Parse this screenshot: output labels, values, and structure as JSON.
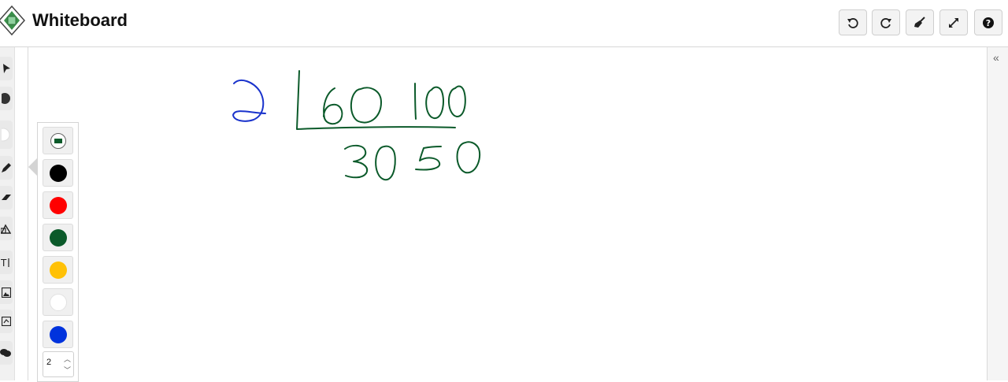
{
  "header": {
    "title": "Whiteboard",
    "buttons": [
      {
        "name": "undo-button",
        "icon": "undo-icon"
      },
      {
        "name": "redo-button",
        "icon": "redo-icon"
      },
      {
        "name": "clear-button",
        "icon": "broom-icon"
      },
      {
        "name": "fullscreen-button",
        "icon": "expand-icon"
      },
      {
        "name": "help-button",
        "icon": "question-icon"
      }
    ]
  },
  "toolbar": {
    "tools": [
      "pointer-icon",
      "filled-circle-icon",
      "empty-circle-icon",
      "pencil-icon",
      "eraser-icon",
      "shapes-icon",
      "text-icon",
      "image-icon",
      "fill-icon",
      "comment-icon"
    ]
  },
  "palette": {
    "colors": [
      {
        "name": "selected-color",
        "hex": "#0b5a2a"
      },
      {
        "name": "black",
        "hex": "#000000"
      },
      {
        "name": "red",
        "hex": "#ff0000"
      },
      {
        "name": "green",
        "hex": "#0b5a2a"
      },
      {
        "name": "yellow",
        "hex": "#ffc107"
      },
      {
        "name": "white",
        "hex": "#ffffff"
      },
      {
        "name": "blue",
        "hex": "#0033dd"
      }
    ],
    "stroke_width": "2"
  },
  "colors": {
    "ink_green": "#0b5a2a",
    "ink_blue": "#1a33cc"
  }
}
